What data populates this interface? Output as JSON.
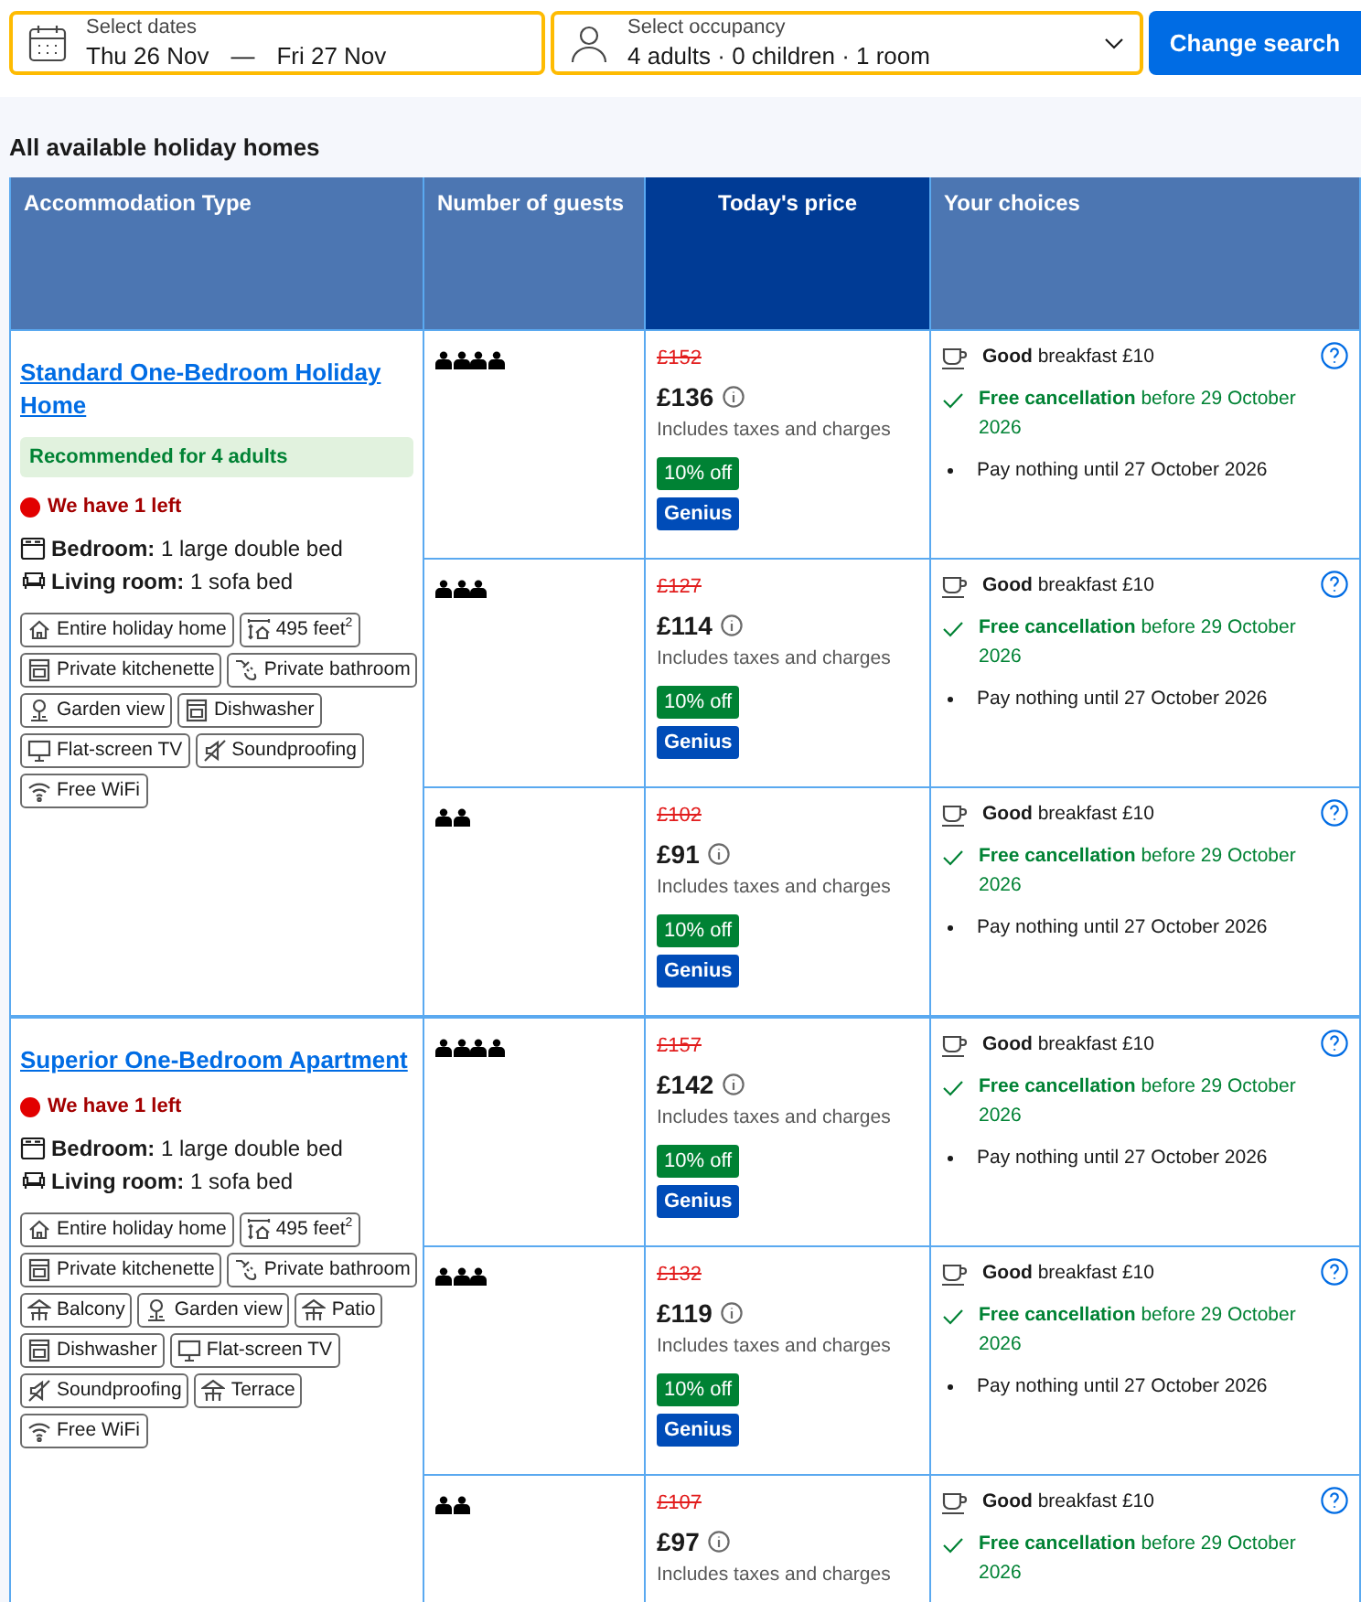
{
  "search_bar": {
    "dates": {
      "label": "Select dates",
      "check_in": "Thu 26 Nov",
      "separator": "—",
      "check_out": "Fri 27 Nov"
    },
    "occupancy": {
      "label": "Select occupancy",
      "value": "4 adults · 0 children · 1 room"
    },
    "button": "Change search"
  },
  "section_title": "All available holiday homes",
  "table": {
    "columns": [
      {
        "label": "Accommodation Type",
        "highlighted": false
      },
      {
        "label": "Number of guests",
        "highlighted": false
      },
      {
        "label": "Today's price",
        "highlighted": true
      },
      {
        "label": "Your choices",
        "highlighted": false
      }
    ],
    "rooms": [
      {
        "name": "Standard One-Bedroom Holiday Home",
        "recommendation": "Recommended for 4 adults",
        "availability": "We have 1 left",
        "beds": [
          {
            "kind": "bedroom",
            "room": "Bedroom:",
            "bed": "1 large double bed"
          },
          {
            "kind": "living",
            "room": "Living room:",
            "bed": "1 sofa bed"
          }
        ],
        "facilities": [
          {
            "kind": "house",
            "label": "Entire holiday home"
          },
          {
            "kind": "size",
            "label": "495 feet$^{2}$"
          },
          {
            "kind": "kitchen",
            "label": "Private kitchenette"
          },
          {
            "kind": "bath",
            "label": "Private bathroom"
          },
          {
            "kind": "garden",
            "label": "Garden view"
          },
          {
            "kind": "dishwasher",
            "label": "Dishwasher"
          },
          {
            "kind": "tv",
            "label": "Flat-screen TV"
          },
          {
            "kind": "sound",
            "label": "Soundproofing"
          },
          {
            "kind": "wifi",
            "label": "Free WiFi"
          }
        ],
        "options": [
          {
            "guests": [
              {
                "kind": "adult"
              },
              {
                "kind": "adult"
              },
              {
                "kind": "adult"
              },
              {
                "kind": "adult"
              }
            ],
            "old_price": "£152",
            "price": "£136",
            "taxes_note": "Includes taxes and charges",
            "badges": [
              {
                "kind": "discount",
                "label": "10% off"
              },
              {
                "kind": "genius",
                "label": "Genius"
              }
            ],
            "choices": [
              {
                "kind": "meal",
                "text": "**Good** breakfast £10"
              },
              {
                "kind": "cancellation",
                "text": "**Free cancellation** before 29 October 2026"
              },
              {
                "kind": "payment",
                "text": "Pay nothing until 27 October 2026"
              }
            ]
          },
          {
            "guests": [
              {
                "kind": "adult"
              },
              {
                "kind": "adult"
              },
              {
                "kind": "adult"
              }
            ],
            "old_price": "£127",
            "price": "£114",
            "taxes_note": "Includes taxes and charges",
            "badges": [
              {
                "kind": "discount",
                "label": "10% off"
              },
              {
                "kind": "genius",
                "label": "Genius"
              }
            ],
            "choices": [
              {
                "kind": "meal",
                "text": "**Good** breakfast £10"
              },
              {
                "kind": "cancellation",
                "text": "**Free cancellation** before 29 October 2026"
              },
              {
                "kind": "payment",
                "text": "Pay nothing until 27 October 2026"
              }
            ]
          },
          {
            "guests": [
              {
                "kind": "adult"
              },
              {
                "kind": "adult"
              }
            ],
            "old_price": "£102",
            "price": "£91",
            "taxes_note": "Includes taxes and charges",
            "badges": [
              {
                "kind": "discount",
                "label": "10% off"
              },
              {
                "kind": "genius",
                "label": "Genius"
              }
            ],
            "choices": [
              {
                "kind": "meal",
                "text": "**Good** breakfast £10"
              },
              {
                "kind": "cancellation",
                "text": "**Free cancellation** before 29 October 2026"
              },
              {
                "kind": "payment",
                "text": "Pay nothing until 27 October 2026"
              }
            ]
          }
        ]
      },
      {
        "name": "Superior One-Bedroom Apartment",
        "availability": "We have 1 left",
        "beds": [
          {
            "kind": "bedroom",
            "room": "Bedroom:",
            "bed": "1 large double bed"
          },
          {
            "kind": "living",
            "room": "Living room:",
            "bed": "1 sofa bed"
          }
        ],
        "facilities": [
          {
            "kind": "house",
            "label": "Entire holiday home"
          },
          {
            "kind": "size",
            "label": "495 feet$^{2}$"
          },
          {
            "kind": "kitchen",
            "label": "Private kitchenette"
          },
          {
            "kind": "bath",
            "label": "Private bathroom"
          },
          {
            "kind": "outdoor",
            "label": "Balcony"
          },
          {
            "kind": "garden",
            "label": "Garden view"
          },
          {
            "kind": "outdoor",
            "label": "Patio"
          },
          {
            "kind": "dishwasher",
            "label": "Dishwasher"
          },
          {
            "kind": "tv",
            "label": "Flat-screen TV"
          },
          {
            "kind": "sound",
            "label": "Soundproofing"
          },
          {
            "kind": "outdoor",
            "label": "Terrace"
          },
          {
            "kind": "wifi",
            "label": "Free WiFi"
          }
        ],
        "options": [
          {
            "guests": [
              {
                "kind": "adult"
              },
              {
                "kind": "adult"
              },
              {
                "kind": "adult"
              },
              {
                "kind": "adult"
              }
            ],
            "old_price": "£157",
            "price": "£142",
            "taxes_note": "Includes taxes and charges",
            "badges": [
              {
                "kind": "discount",
                "label": "10% off"
              },
              {
                "kind": "genius",
                "label": "Genius"
              }
            ],
            "choices": [
              {
                "kind": "meal",
                "text": "**Good** breakfast £10"
              },
              {
                "kind": "cancellation",
                "text": "**Free cancellation** before 29 October 2026"
              },
              {
                "kind": "payment",
                "text": "Pay nothing until 27 October 2026"
              }
            ]
          },
          {
            "guests": [
              {
                "kind": "adult"
              },
              {
                "kind": "adult"
              },
              {
                "kind": "adult"
              }
            ],
            "old_price": "£132",
            "price": "£119",
            "taxes_note": "Includes taxes and charges",
            "badges": [
              {
                "kind": "discount",
                "label": "10% off"
              },
              {
                "kind": "genius",
                "label": "Genius"
              }
            ],
            "choices": [
              {
                "kind": "meal",
                "text": "**Good** breakfast £10"
              },
              {
                "kind": "cancellation",
                "text": "**Free cancellation** before 29 October 2026"
              },
              {
                "kind": "payment",
                "text": "Pay nothing until 27 October 2026"
              }
            ]
          },
          {
            "guests": [
              {
                "kind": "adult"
              },
              {
                "kind": "adult"
              }
            ],
            "old_price": "£107",
            "price": "£97",
            "taxes_note": "Includes taxes and charges",
            "choices": [
              {
                "kind": "meal",
                "text": "**Good** breakfast £10"
              },
              {
                "kind": "cancellation",
                "text": "**Free cancellation** before 29 October 2026"
              }
            ]
          }
        ]
      }
    ]
  }
}
